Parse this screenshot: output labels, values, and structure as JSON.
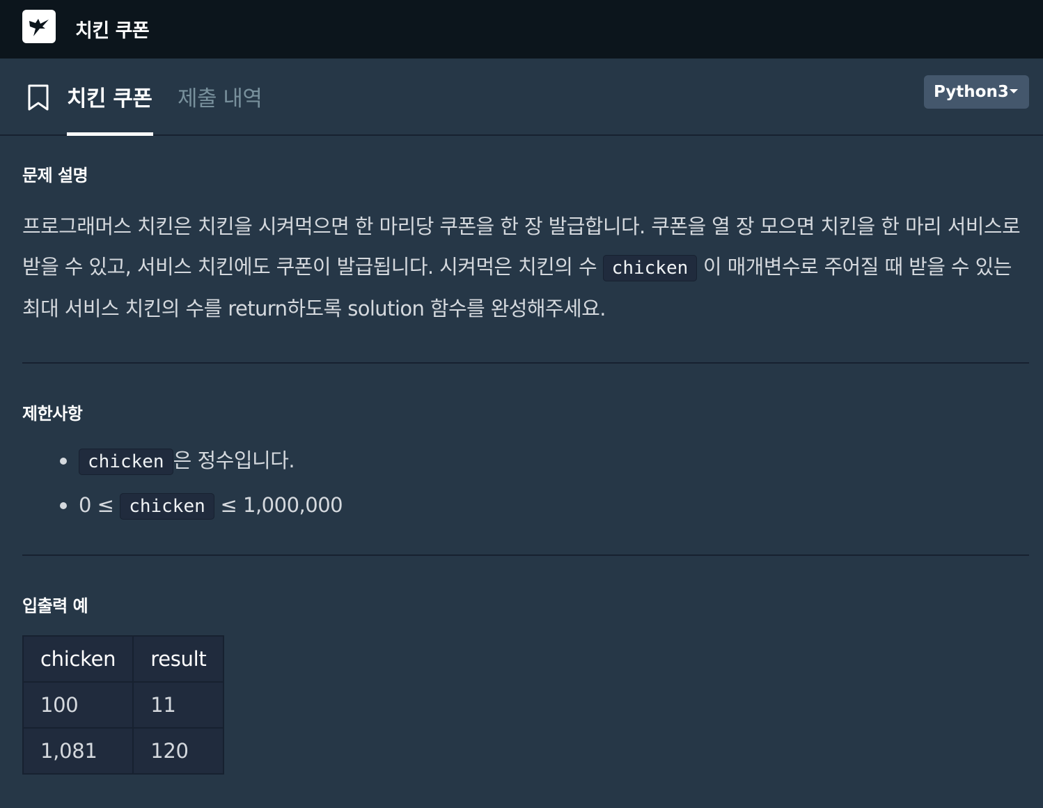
{
  "topbar": {
    "logo_icon": "hummingbird-logo-icon",
    "title": "치킨 쿠폰"
  },
  "tabs": {
    "bookmark_icon": "bookmark-icon",
    "active_label": "치킨 쿠폰",
    "history_label": "제출 내역"
  },
  "language": {
    "selected": "Python3",
    "caret_icon": "caret-down-icon"
  },
  "description": {
    "heading": "문제 설명",
    "text_part1": "프로그래머스 치킨은 치킨을 시켜먹으면 한 마리당 쿠폰을 한 장 발급합니다. 쿠폰을 열 장 모으면 치킨을 한 마리 서비스로 받을 수 있고, 서비스 치킨에도 쿠폰이 발급됩니다. 시켜먹은 치킨의 수 ",
    "code1": "chicken",
    "text_part2": "이 매개변수로 주어질 때 받을 수 있는 최대 서비스 치킨의 수를 return하도록 solution 함수를 완성해주세요."
  },
  "constraints": {
    "heading": "제한사항",
    "item1_code": "chicken",
    "item1_text": "은 정수입니다.",
    "item2_prefix": "0 ≤ ",
    "item2_code": "chicken",
    "item2_suffix": " ≤ 1,000,000"
  },
  "examples": {
    "heading": "입출력 예",
    "headers": [
      "chicken",
      "result"
    ],
    "rows": [
      [
        "100",
        "11"
      ],
      [
        "1,081",
        "120"
      ]
    ]
  },
  "colors": {
    "topbar_bg": "#0c151c",
    "page_bg": "#263747",
    "code_bg": "#202b3d",
    "select_bg": "#44576c",
    "muted_tab": "#78909c"
  }
}
